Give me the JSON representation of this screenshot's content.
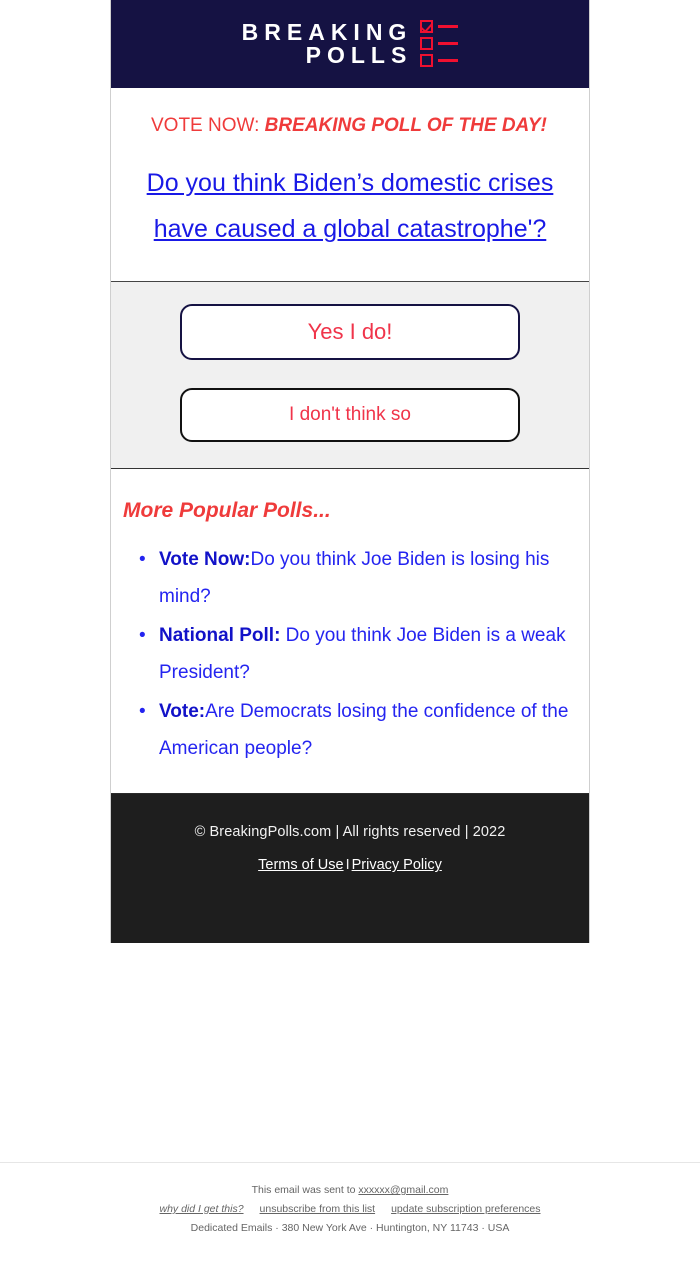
{
  "logo": {
    "line1": "BREAKING",
    "line2": "POLLS",
    "checklist_icon": "checklist-icon",
    "brand_navy": "#151243",
    "brand_red": "#f01030"
  },
  "kicker": {
    "prefix": "VOTE NOW: ",
    "emphasis": "BREAKING POLL OF THE DAY!"
  },
  "question": {
    "text": "Do you think Biden’s domestic crises have caused a global catastrophe'?",
    "color": "#1919e6"
  },
  "vote": {
    "yes_label": "Yes I do!",
    "no_label": "I don't think so"
  },
  "more_polls": {
    "title": "More Popular Polls...",
    "items": [
      {
        "lead": "Vote Now:",
        "text": "Do you think Joe Biden is losing his mind?"
      },
      {
        "lead": "National Poll:",
        "text": " Do you think Joe Biden is a weak President?"
      },
      {
        "lead": "Vote:",
        "text": "Are Democrats losing the confidence of the American people?"
      }
    ]
  },
  "footer": {
    "copyright": "© BreakingPolls.com | All rights reserved | 2022",
    "terms_label": "Terms of Use",
    "separator": "I",
    "privacy_label": "Privacy Policy"
  },
  "mailchimp": {
    "sent_to_prefix": "This email was sent to ",
    "recipient": "xxxxxx@gmail.com",
    "why_label": "why did I get this?",
    "unsubscribe_label": "unsubscribe from this list",
    "update_label": "update subscription preferences",
    "address": "Dedicated Emails · 380 New York Ave · Huntington, NY 11743 · USA"
  }
}
